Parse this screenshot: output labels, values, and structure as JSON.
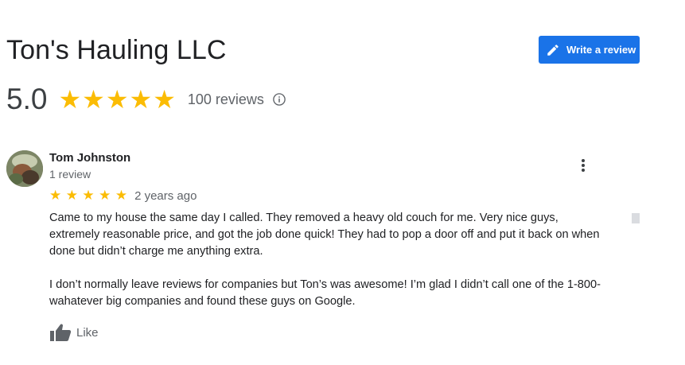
{
  "business": {
    "name": "Ton's Hauling LLC",
    "rating": "5.0",
    "review_count": "100 reviews",
    "stars": [
      "★",
      "★",
      "★",
      "★",
      "★"
    ]
  },
  "actions": {
    "write_review_label": "Write a review"
  },
  "review": {
    "author": "Tom Johnston",
    "author_meta": "1 review",
    "stars": [
      "★",
      "★",
      "★",
      "★",
      "★"
    ],
    "date": "2 years ago",
    "paragraphs": [
      "Came to my house the same day I called. They removed a heavy old couch for me. Very nice guys, extremely reasonable price, and got the job done quick! They had to pop a door off and put it back on when done but didn’t charge me anything extra.",
      "I don’t normally leave reviews for companies but Ton’s was awesome! I’m glad I didn’t call one of the 1-800-wahatever big companies and found these guys on Google."
    ],
    "like_label": "Like"
  },
  "colors": {
    "accent": "#1a73e8",
    "star": "#fbbc04",
    "secondary_text": "#5f6368"
  }
}
